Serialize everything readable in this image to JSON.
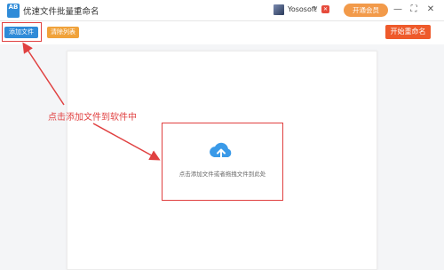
{
  "window": {
    "title": "优速文件批量重命名",
    "logo_text": "AB",
    "controls": {
      "minimize": "—",
      "restore": "⛶",
      "close": "✕"
    }
  },
  "user": {
    "name": "Yososoft",
    "dropdown": "∨",
    "badge": "✕",
    "vip_label": "开通会员"
  },
  "toolbar": {
    "add_file_label": "添加文件",
    "clear_list_label": "清除列表",
    "start_rename_label": "开始重命名"
  },
  "workspace": {
    "drop_hint": "点击添加文件或者拖拽文件到此处"
  },
  "annotation": {
    "text": "点击添加文件到软件中",
    "color": "#e04040"
  },
  "colors": {
    "accent_blue": "#2f8bd8",
    "clear_orange": "#f0a23a",
    "start_red": "#ee5a2b",
    "vip_orange": "#f29a4a",
    "cloud_blue": "#3a9ae8"
  }
}
